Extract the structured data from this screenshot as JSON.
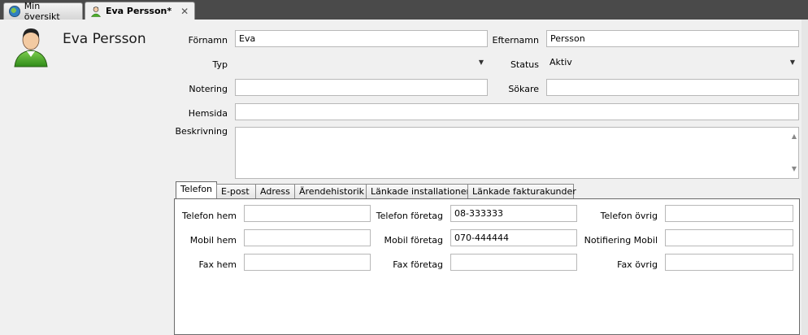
{
  "doc_tabs": [
    {
      "label": "Min översikt",
      "icon": "globe-icon"
    },
    {
      "label": "Eva Persson*",
      "icon": "person-icon",
      "close": "✕"
    }
  ],
  "header": {
    "name": "Eva Persson"
  },
  "form": {
    "fornamn_label": "Förnamn",
    "fornamn_value": "Eva",
    "efternamn_label": "Efternamn",
    "efternamn_value": "Persson",
    "typ_label": "Typ",
    "typ_value": "",
    "status_label": "Status",
    "status_value": "Aktiv",
    "notering_label": "Notering",
    "notering_value": "",
    "sokare_label": "Sökare",
    "sokare_value": "",
    "hemsida_label": "Hemsida",
    "hemsida_value": "",
    "beskrivning_label": "Beskrivning",
    "beskrivning_value": ""
  },
  "tabs": [
    "Telefon",
    "E-post",
    "Adress",
    "Ärendehistorik",
    "Länkade installationer",
    "Länkade fakturakunder"
  ],
  "phone": {
    "telefon_hem_label": "Telefon hem",
    "telefon_hem_value": "",
    "telefon_foretag_label": "Telefon företag",
    "telefon_foretag_value": "08-333333",
    "telefon_ovrig_label": "Telefon övrig",
    "telefon_ovrig_value": "",
    "mobil_hem_label": "Mobil hem",
    "mobil_hem_value": "",
    "mobil_foretag_label": "Mobil företag",
    "mobil_foretag_value": "070-444444",
    "notifiering_mobil_label": "Notifiering Mobil",
    "notifiering_mobil_value": "",
    "fax_hem_label": "Fax hem",
    "fax_hem_value": "",
    "fax_foretag_label": "Fax företag",
    "fax_foretag_value": "",
    "fax_ovrig_label": "Fax övrig",
    "fax_ovrig_value": ""
  }
}
